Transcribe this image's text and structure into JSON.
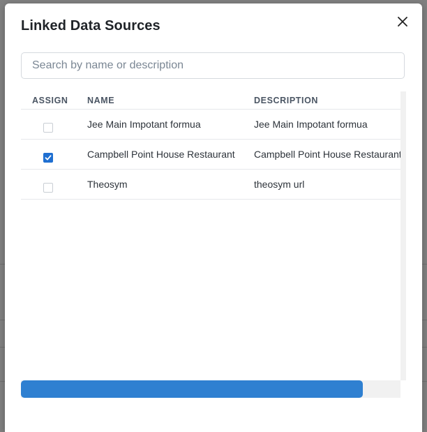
{
  "dialog": {
    "title": "Linked Data Sources",
    "search": {
      "placeholder": "Search by name or description",
      "value": ""
    },
    "columns": {
      "assign": "ASSIGN",
      "name": "NAME",
      "description": "DESCRIPTION"
    },
    "rows": [
      {
        "assigned": false,
        "name": "Jee Main Impotant formua",
        "description": "Jee Main Impotant formua"
      },
      {
        "assigned": true,
        "name": "Campbell Point House Restaurant",
        "description": "Campbell Point House Restaurant"
      },
      {
        "assigned": false,
        "name": "Theosym",
        "description": "theosym url"
      }
    ],
    "horizontal_scroll_fraction": 0.9
  },
  "colors": {
    "accent": "#1f6fd1",
    "scroll_thumb": "#2f80d1"
  },
  "icons": {
    "close": "close-icon",
    "check": "checkmark-icon"
  }
}
